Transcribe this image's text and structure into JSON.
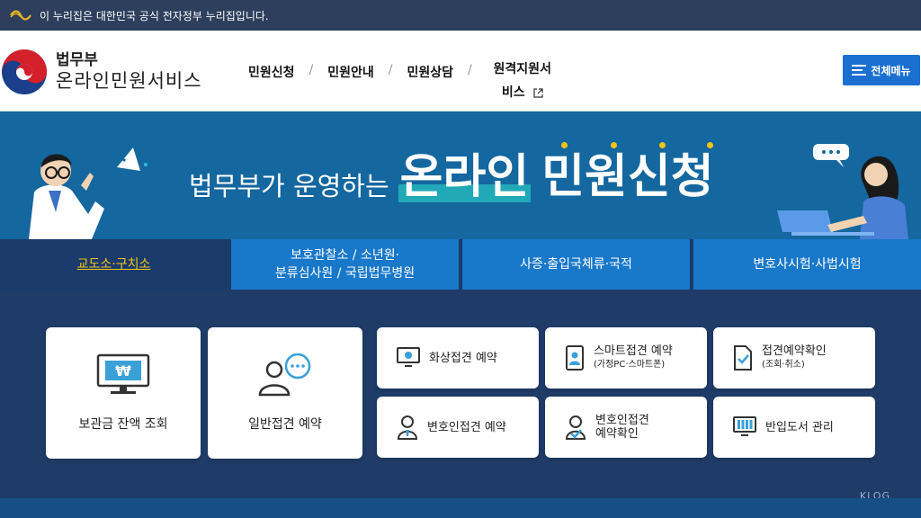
{
  "gov_bar": {
    "text": "이 누리집은 대한민국 공식 전자정부 누리집입니다."
  },
  "header": {
    "brand_sub": "법무부",
    "brand_main": "온라인민원서비스",
    "nav": [
      {
        "label": "민원신청"
      },
      {
        "label": "민원안내"
      },
      {
        "label": "민원상담"
      },
      {
        "label_line1": "원격지원서",
        "label_line2": "비스"
      }
    ],
    "separator": "/",
    "all_menu_label": "전체메뉴"
  },
  "hero": {
    "prefix": "법무부가 운영하는",
    "emph1": "온라인",
    "emph2": "민원신청"
  },
  "tabs": [
    {
      "label": "교도소·구치소",
      "active": true
    },
    {
      "line1": "보호관찰소 / 소년원·",
      "line2": "분류심사원 / 국립법무병원"
    },
    {
      "label": "사증·출입국체류·국적"
    },
    {
      "label": "변호사시험·사법시험"
    }
  ],
  "cards": {
    "big": [
      {
        "label": "보관금 잔액 조회",
        "icon": "money-monitor-icon"
      },
      {
        "label": "일반접견 예약",
        "icon": "person-chat-icon"
      }
    ],
    "small": [
      {
        "label": "화상접견 예약",
        "icon": "video-monitor-icon"
      },
      {
        "label": "스마트접견 예약",
        "sub": "(가정PC·스마트폰)",
        "icon": "smartphone-icon"
      },
      {
        "label": "접견예약확인",
        "sub": "(조회·취소)",
        "icon": "document-check-icon"
      },
      {
        "label": "변호인접견 예약",
        "icon": "lawyer-icon"
      },
      {
        "label": "변호인접견",
        "sub": "예약확인",
        "icon": "lawyer-check-icon"
      },
      {
        "label": "반입도서 관리",
        "icon": "book-monitor-icon"
      }
    ]
  },
  "watermark": "KLOG",
  "colors": {
    "gov_bar": "#2d3f5c",
    "hero": "#14679f",
    "tab": "#1878c9",
    "tab_active": "#1a3b6b",
    "content_bg": "#1f3b68",
    "accent_yellow": "#f2c318",
    "all_menu": "#1a6fd1"
  }
}
